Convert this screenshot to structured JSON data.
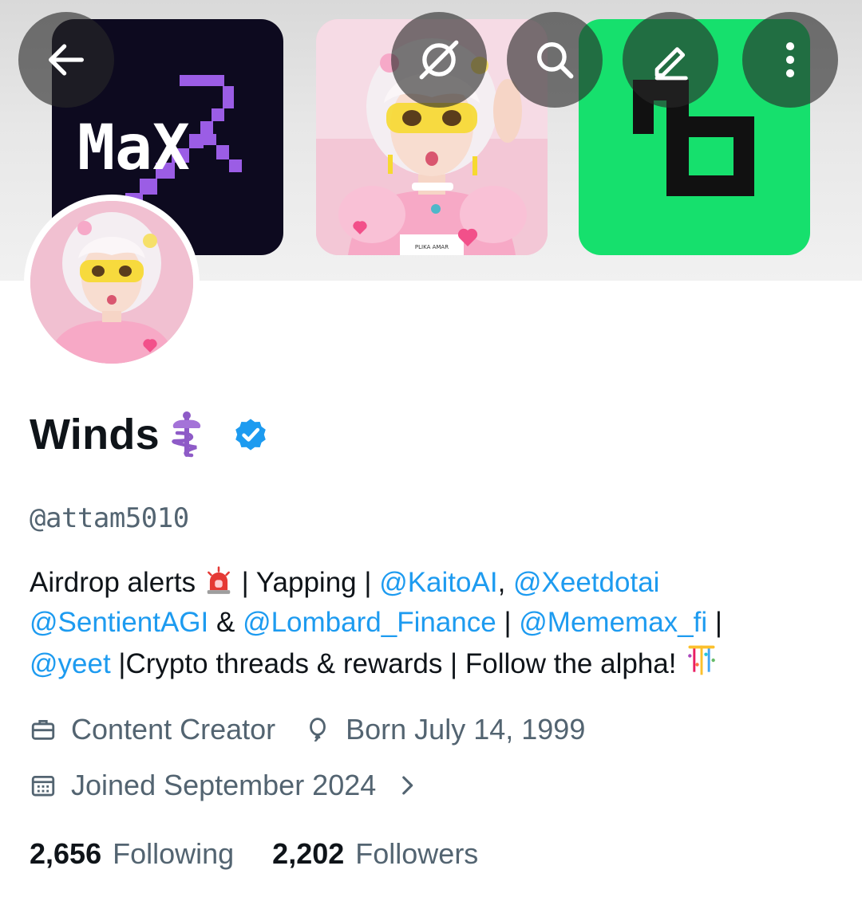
{
  "banner": {
    "tile1_text": "MaX",
    "tile2_badge": "PLIKA AMAR",
    "colors": {
      "tile1_bg": "#0d0a1f",
      "tile1_accent": "#9b5de5",
      "tile3_bg": "#16e06d"
    }
  },
  "topbar": {
    "icons": [
      "back-arrow-icon",
      "grok-icon",
      "search-icon",
      "pencil-icon",
      "more-vertical-icon"
    ]
  },
  "profile": {
    "display_name": "Winds",
    "name_emoji": "caduceus",
    "verified": true,
    "handle": "@attam5010",
    "bio": {
      "t1": "Airdrop alerts ",
      "t2": " | Yapping | ",
      "m1": "@KaitoAI",
      "t3": ", ",
      "m2": "@Xeetdotai",
      "m3": "@SentientAGI",
      "t4": " & ",
      "m4": "@Lombard_Finance",
      "t5": " | ",
      "m5": "@Mememax_fi",
      "t6": " | ",
      "m6": "@yeet",
      "t7": " |Crypto threads & rewards | Follow the alpha! "
    },
    "profession": "Content Creator",
    "birthday": "Born July 14, 1999",
    "joined": "Joined September 2024",
    "following_count": "2,656",
    "following_label": "Following",
    "followers_count": "2,202",
    "followers_label": "Followers"
  },
  "colors": {
    "link": "#1d9bf0",
    "muted": "#536471",
    "text": "#0f1419",
    "verified": "#1d9bf0"
  }
}
